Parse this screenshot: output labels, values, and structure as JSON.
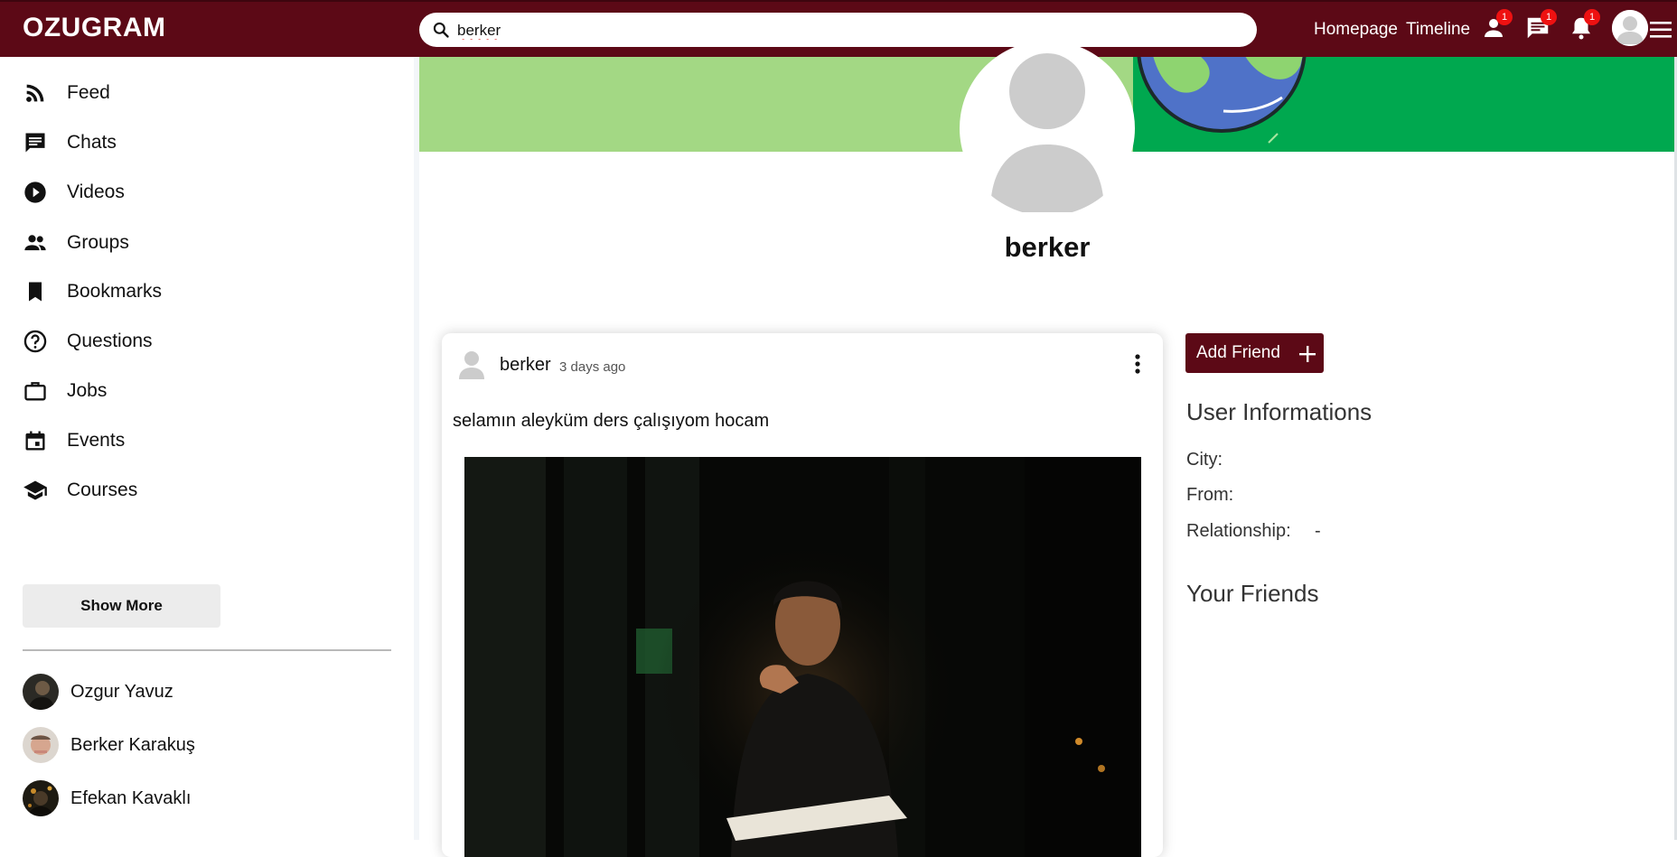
{
  "header": {
    "logo": "OZUGRAM",
    "search_value": "berker",
    "links": [
      "Homepage",
      "Timeline"
    ],
    "badges": {
      "friend_requests": "1",
      "messages": "1",
      "notifications": "1"
    },
    "icons": [
      "search-icon",
      "person-icon",
      "chat-icon",
      "bell-icon",
      "menu-icon"
    ]
  },
  "sidebar": {
    "items": [
      {
        "label": "Feed",
        "icon": "rss-icon"
      },
      {
        "label": "Chats",
        "icon": "chat-icon"
      },
      {
        "label": "Videos",
        "icon": "play-circle-icon"
      },
      {
        "label": "Groups",
        "icon": "group-icon"
      },
      {
        "label": "Bookmarks",
        "icon": "bookmark-icon"
      },
      {
        "label": "Questions",
        "icon": "help-circle-icon"
      },
      {
        "label": "Jobs",
        "icon": "briefcase-icon"
      },
      {
        "label": "Events",
        "icon": "calendar-icon"
      },
      {
        "label": "Courses",
        "icon": "school-icon"
      }
    ],
    "show_more": "Show More",
    "friends": [
      "Ozgur Yavuz",
      "Berker Karakuş",
      "Efekan Kavaklı"
    ]
  },
  "profile": {
    "name": "berker"
  },
  "post": {
    "username": "berker",
    "time": "3 days ago",
    "text": "selamın aleyküm ders çalışıyom hocam"
  },
  "right_panel": {
    "add_friend": "Add Friend",
    "info_title": "User Informations",
    "city_label": "City:",
    "from_label": "From:",
    "relationship_label": "Relationship:",
    "relationship_value": "-",
    "friends_title": "Your Friends"
  },
  "colors": {
    "brand": "#5c0916",
    "badge": "#e11111",
    "cover_light": "#a3d884",
    "cover_dark": "#00a84f"
  }
}
